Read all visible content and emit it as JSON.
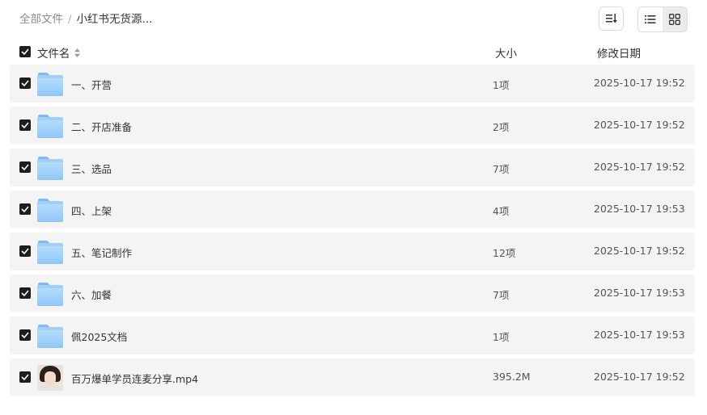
{
  "breadcrumb": {
    "root": "全部文件",
    "separator": "/",
    "current": "小红书无货源..."
  },
  "toolbar": {
    "sort_icon": "sort-icon",
    "views": [
      {
        "name": "list-view-icon",
        "active": false
      },
      {
        "name": "grid-view-icon",
        "active": true
      }
    ]
  },
  "columns": {
    "name": "文件名",
    "size": "大小",
    "date": "修改日期"
  },
  "files": [
    {
      "name": "一、开营",
      "size": "1项",
      "date": "2025-10-17 19:52",
      "type": "folder"
    },
    {
      "name": "二、开店准备",
      "size": "2项",
      "date": "2025-10-17 19:52",
      "type": "folder"
    },
    {
      "name": "三、选品",
      "size": "7项",
      "date": "2025-10-17 19:52",
      "type": "folder"
    },
    {
      "name": "四、上架",
      "size": "4项",
      "date": "2025-10-17 19:53",
      "type": "folder"
    },
    {
      "name": "五、笔记制作",
      "size": "12项",
      "date": "2025-10-17 19:52",
      "type": "folder"
    },
    {
      "name": "六、加餐",
      "size": "7项",
      "date": "2025-10-17 19:53",
      "type": "folder"
    },
    {
      "name": "佩2025文档",
      "size": "1项",
      "date": "2025-10-17 19:53",
      "type": "folder"
    },
    {
      "name": "百万爆单学员连麦分享.mp4",
      "size": "395.2M",
      "date": "2025-10-17 19:52",
      "type": "video"
    }
  ],
  "colors": {
    "row_bg": "#f4f4f5",
    "checkbox": "#1e1e1e",
    "folder": "#9fd0fa"
  }
}
